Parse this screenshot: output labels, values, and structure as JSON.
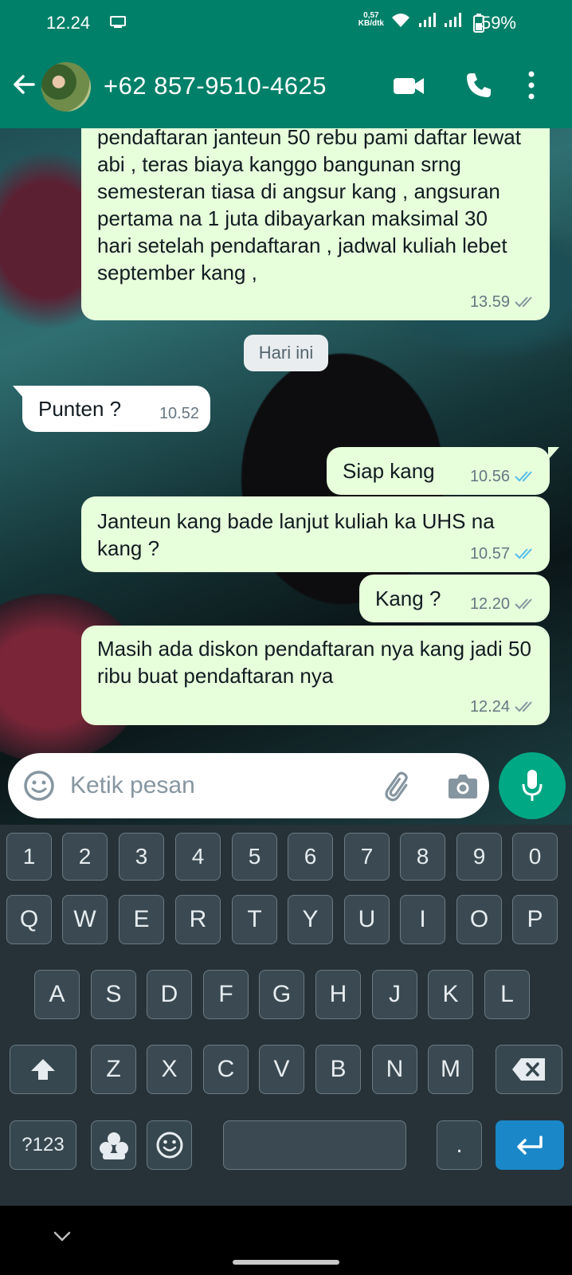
{
  "status_bar": {
    "time": "12.24",
    "net_speed_value": "0,57",
    "net_speed_unit": "KB/dtk",
    "battery": "59%"
  },
  "header": {
    "contact": "+62 857-9510-4625"
  },
  "chat": {
    "messages": [
      {
        "direction": "outgoing",
        "text": "pendaftaran janteun 50 rebu pami daftar lewat abi , teras biaya kanggo bangunan srng semesteran tiasa di angsur kang , angsuran pertama na 1 juta dibayarkan maksimal 30 hari setelah pendaftaran , jadwal kuliah lebet september kang ,",
        "time": "13.59",
        "status": "delivered"
      },
      {
        "direction": "incoming",
        "text": "Punten ?",
        "time": "10.52"
      },
      {
        "direction": "outgoing",
        "text": "Siap kang",
        "time": "10.56",
        "status": "read"
      },
      {
        "direction": "outgoing",
        "text": "Janteun kang bade lanjut kuliah ka UHS na kang ?",
        "time": "10.57",
        "status": "read"
      },
      {
        "direction": "outgoing",
        "text": "Kang ?",
        "time": "12.20",
        "status": "delivered"
      },
      {
        "direction": "outgoing",
        "text": "Masih ada diskon pendaftaran nya kang jadi 50 ribu buat pendaftaran nya",
        "time": "12.24",
        "status": "delivered"
      }
    ],
    "date_divider": "Hari ini"
  },
  "input": {
    "placeholder": "Ketik pesan"
  },
  "keyboard": {
    "row_numbers": [
      "1",
      "2",
      "3",
      "4",
      "5",
      "6",
      "7",
      "8",
      "9",
      "0"
    ],
    "row1": [
      "Q",
      "W",
      "E",
      "R",
      "T",
      "Y",
      "U",
      "I",
      "O",
      "P"
    ],
    "row2": [
      "A",
      "S",
      "D",
      "F",
      "G",
      "H",
      "J",
      "K",
      "L"
    ],
    "row3": [
      "Z",
      "X",
      "C",
      "V",
      "B",
      "N",
      "M"
    ],
    "symbols_label": "?123",
    "period_label": "."
  },
  "colors": {
    "header_green": "#008069",
    "outgoing_bubble": "#e7ffdb",
    "read_tick": "#53bdeb",
    "mic_green": "#00a884",
    "enter_blue": "#1a88c8"
  }
}
